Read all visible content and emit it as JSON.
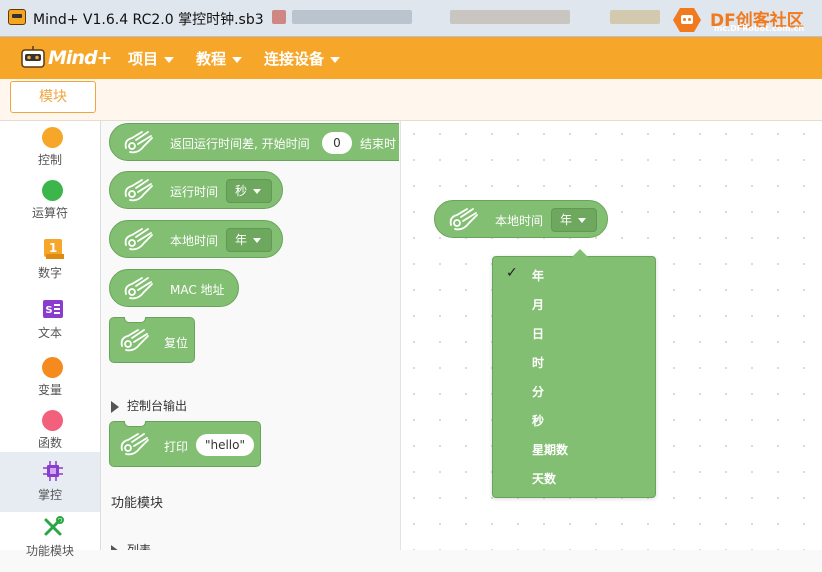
{
  "window": {
    "title": "Mind+ V1.6.4 RC2.0   掌控时钟.sb3",
    "df_logo_text": "DF创客社区",
    "df_logo_url": "mc.DFRobot.com.cn"
  },
  "menubar": {
    "logo_text": "Mind+",
    "items": [
      "项目",
      "教程",
      "连接设备"
    ]
  },
  "tabs": {
    "blocks_label": "模块"
  },
  "categories": [
    {
      "label": "控制",
      "color": "#f6a628"
    },
    {
      "label": "运算符",
      "color": "#3cb54a"
    },
    {
      "label": "数字",
      "color": "#f6a628"
    },
    {
      "label": "文本",
      "color": "#8a3ccf"
    },
    {
      "label": "变量",
      "color": "#f58b1f"
    },
    {
      "label": "函数",
      "color": "#f2607c"
    },
    {
      "label": "掌控",
      "color": "#8a3ccf"
    },
    {
      "label": "功能模块",
      "color": "#2aa745"
    }
  ],
  "flyout": {
    "block_elapsed": {
      "text": "返回运行时间差, 开始时间",
      "value": "0",
      "text2": "结束时"
    },
    "block_runtime": {
      "text": "运行时间",
      "dropdown": "秒"
    },
    "block_localtime": {
      "text": "本地时间",
      "dropdown": "年"
    },
    "block_mac": {
      "text": "MAC 地址"
    },
    "block_reset": {
      "text": "复位"
    },
    "section_console": "控制台输出",
    "block_print": {
      "text": "打印",
      "value": "\"hello\""
    },
    "section_function": "功能模块",
    "section_list": "列表"
  },
  "workspace": {
    "block": {
      "text": "本地时间",
      "dropdown": "年"
    },
    "dropdown_options": [
      "年",
      "月",
      "日",
      "时",
      "分",
      "秒",
      "星期数",
      "天数"
    ],
    "selected_option": "年"
  },
  "colors": {
    "block_green": "#82bf72",
    "menubar_orange": "#f6a628"
  }
}
